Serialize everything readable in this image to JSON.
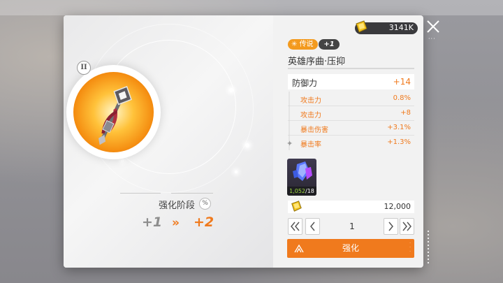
{
  "currency": {
    "value": "3141K",
    "icon": "crystal-icon"
  },
  "item": {
    "rarity": "传说",
    "level": "+1",
    "name": "英雄序曲·压抑",
    "rank": "II"
  },
  "stats": {
    "main": {
      "label": "防御力",
      "value": "+14"
    },
    "subs": [
      {
        "label": "攻击力",
        "value": "0.8%"
      },
      {
        "label": "攻击力",
        "value": "+8"
      },
      {
        "label": "暴击伤害",
        "value": "+3.1%"
      },
      {
        "label": "暴击率",
        "value": "+1.3%"
      }
    ]
  },
  "enhance_stage": {
    "label": "强化阶段",
    "from": "+1",
    "arrow": "»",
    "to": "+2",
    "info_icon": "%"
  },
  "material": {
    "have": "1,052",
    "need": "/18",
    "icon": "blue-crystal-icon"
  },
  "cost": {
    "value": "12,000",
    "icon": "gold-icon"
  },
  "stepper": {
    "value": "1"
  },
  "enhance_button": {
    "label": "强化"
  },
  "colors": {
    "accent": "#f07a1d",
    "rarity": "#f39a1e",
    "panel": "#f2f2f2"
  }
}
